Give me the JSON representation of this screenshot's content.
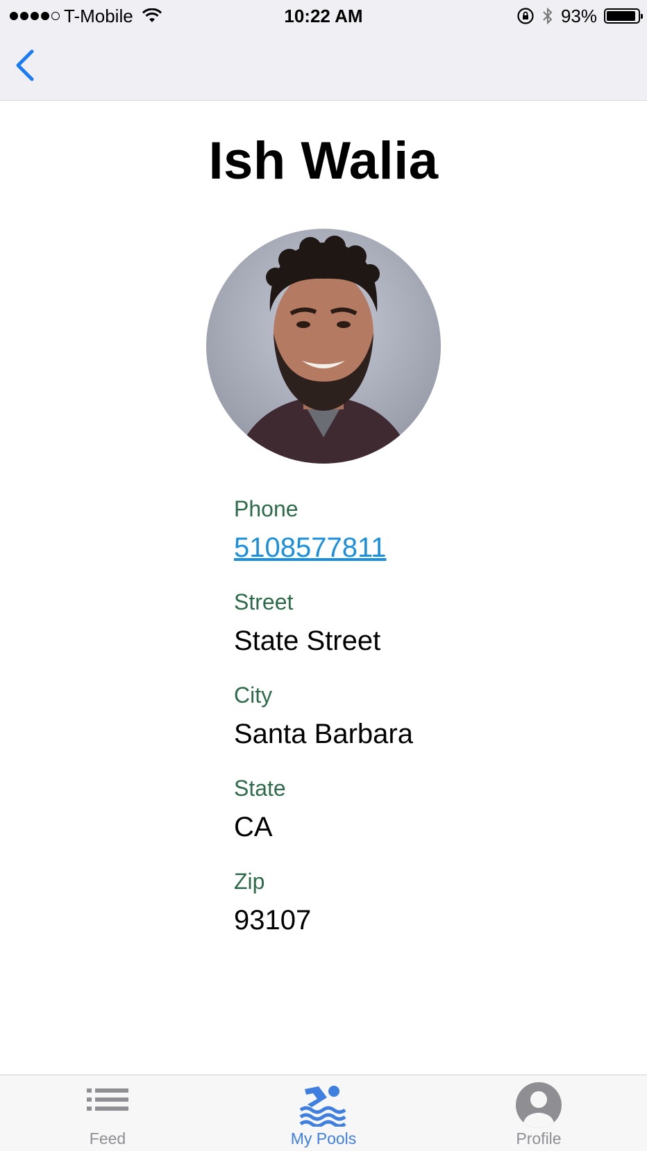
{
  "status_bar": {
    "carrier": "T-Mobile",
    "time": "10:22 AM",
    "battery_percent": "93%",
    "battery_level": 0.93,
    "signal_bars": 4,
    "signal_total": 5
  },
  "nav": {
    "back_icon": "chevron-left-icon",
    "accent": "#1a7cf5"
  },
  "profile": {
    "name": "Ish Walia",
    "avatar_icon": "profile-photo"
  },
  "fields": {
    "phone": {
      "label": "Phone",
      "value": "5108577811"
    },
    "street": {
      "label": "Street",
      "value": "State Street"
    },
    "city": {
      "label": "City",
      "value": "Santa Barbara"
    },
    "state": {
      "label": "State",
      "value": "CA"
    },
    "zip": {
      "label": "Zip",
      "value": "93107"
    }
  },
  "tab_bar": {
    "tabs": [
      {
        "label": "Feed",
        "icon": "list-icon",
        "active": false
      },
      {
        "label": "My Pools",
        "icon": "swimmer-icon",
        "active": true
      },
      {
        "label": "Profile",
        "icon": "person-icon",
        "active": false
      }
    ],
    "active_color": "#3f7fe0",
    "inactive_color": "#8e8e93"
  },
  "colors": {
    "label_green": "#2e6b4a",
    "link_blue": "#1a8fdd"
  }
}
